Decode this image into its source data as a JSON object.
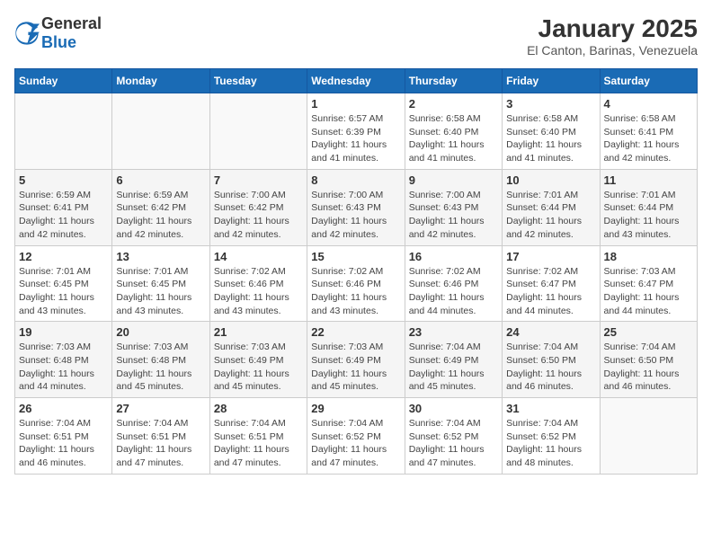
{
  "header": {
    "logo_general": "General",
    "logo_blue": "Blue",
    "title": "January 2025",
    "subtitle": "El Canton, Barinas, Venezuela"
  },
  "weekdays": [
    "Sunday",
    "Monday",
    "Tuesday",
    "Wednesday",
    "Thursday",
    "Friday",
    "Saturday"
  ],
  "weeks": [
    [
      {
        "day": "",
        "info": ""
      },
      {
        "day": "",
        "info": ""
      },
      {
        "day": "",
        "info": ""
      },
      {
        "day": "1",
        "info": "Sunrise: 6:57 AM\nSunset: 6:39 PM\nDaylight: 11 hours\nand 41 minutes."
      },
      {
        "day": "2",
        "info": "Sunrise: 6:58 AM\nSunset: 6:40 PM\nDaylight: 11 hours\nand 41 minutes."
      },
      {
        "day": "3",
        "info": "Sunrise: 6:58 AM\nSunset: 6:40 PM\nDaylight: 11 hours\nand 41 minutes."
      },
      {
        "day": "4",
        "info": "Sunrise: 6:58 AM\nSunset: 6:41 PM\nDaylight: 11 hours\nand 42 minutes."
      }
    ],
    [
      {
        "day": "5",
        "info": "Sunrise: 6:59 AM\nSunset: 6:41 PM\nDaylight: 11 hours\nand 42 minutes."
      },
      {
        "day": "6",
        "info": "Sunrise: 6:59 AM\nSunset: 6:42 PM\nDaylight: 11 hours\nand 42 minutes."
      },
      {
        "day": "7",
        "info": "Sunrise: 7:00 AM\nSunset: 6:42 PM\nDaylight: 11 hours\nand 42 minutes."
      },
      {
        "day": "8",
        "info": "Sunrise: 7:00 AM\nSunset: 6:43 PM\nDaylight: 11 hours\nand 42 minutes."
      },
      {
        "day": "9",
        "info": "Sunrise: 7:00 AM\nSunset: 6:43 PM\nDaylight: 11 hours\nand 42 minutes."
      },
      {
        "day": "10",
        "info": "Sunrise: 7:01 AM\nSunset: 6:44 PM\nDaylight: 11 hours\nand 42 minutes."
      },
      {
        "day": "11",
        "info": "Sunrise: 7:01 AM\nSunset: 6:44 PM\nDaylight: 11 hours\nand 43 minutes."
      }
    ],
    [
      {
        "day": "12",
        "info": "Sunrise: 7:01 AM\nSunset: 6:45 PM\nDaylight: 11 hours\nand 43 minutes."
      },
      {
        "day": "13",
        "info": "Sunrise: 7:01 AM\nSunset: 6:45 PM\nDaylight: 11 hours\nand 43 minutes."
      },
      {
        "day": "14",
        "info": "Sunrise: 7:02 AM\nSunset: 6:46 PM\nDaylight: 11 hours\nand 43 minutes."
      },
      {
        "day": "15",
        "info": "Sunrise: 7:02 AM\nSunset: 6:46 PM\nDaylight: 11 hours\nand 43 minutes."
      },
      {
        "day": "16",
        "info": "Sunrise: 7:02 AM\nSunset: 6:46 PM\nDaylight: 11 hours\nand 44 minutes."
      },
      {
        "day": "17",
        "info": "Sunrise: 7:02 AM\nSunset: 6:47 PM\nDaylight: 11 hours\nand 44 minutes."
      },
      {
        "day": "18",
        "info": "Sunrise: 7:03 AM\nSunset: 6:47 PM\nDaylight: 11 hours\nand 44 minutes."
      }
    ],
    [
      {
        "day": "19",
        "info": "Sunrise: 7:03 AM\nSunset: 6:48 PM\nDaylight: 11 hours\nand 44 minutes."
      },
      {
        "day": "20",
        "info": "Sunrise: 7:03 AM\nSunset: 6:48 PM\nDaylight: 11 hours\nand 45 minutes."
      },
      {
        "day": "21",
        "info": "Sunrise: 7:03 AM\nSunset: 6:49 PM\nDaylight: 11 hours\nand 45 minutes."
      },
      {
        "day": "22",
        "info": "Sunrise: 7:03 AM\nSunset: 6:49 PM\nDaylight: 11 hours\nand 45 minutes."
      },
      {
        "day": "23",
        "info": "Sunrise: 7:04 AM\nSunset: 6:49 PM\nDaylight: 11 hours\nand 45 minutes."
      },
      {
        "day": "24",
        "info": "Sunrise: 7:04 AM\nSunset: 6:50 PM\nDaylight: 11 hours\nand 46 minutes."
      },
      {
        "day": "25",
        "info": "Sunrise: 7:04 AM\nSunset: 6:50 PM\nDaylight: 11 hours\nand 46 minutes."
      }
    ],
    [
      {
        "day": "26",
        "info": "Sunrise: 7:04 AM\nSunset: 6:51 PM\nDaylight: 11 hours\nand 46 minutes."
      },
      {
        "day": "27",
        "info": "Sunrise: 7:04 AM\nSunset: 6:51 PM\nDaylight: 11 hours\nand 47 minutes."
      },
      {
        "day": "28",
        "info": "Sunrise: 7:04 AM\nSunset: 6:51 PM\nDaylight: 11 hours\nand 47 minutes."
      },
      {
        "day": "29",
        "info": "Sunrise: 7:04 AM\nSunset: 6:52 PM\nDaylight: 11 hours\nand 47 minutes."
      },
      {
        "day": "30",
        "info": "Sunrise: 7:04 AM\nSunset: 6:52 PM\nDaylight: 11 hours\nand 47 minutes."
      },
      {
        "day": "31",
        "info": "Sunrise: 7:04 AM\nSunset: 6:52 PM\nDaylight: 11 hours\nand 48 minutes."
      },
      {
        "day": "",
        "info": ""
      }
    ]
  ]
}
